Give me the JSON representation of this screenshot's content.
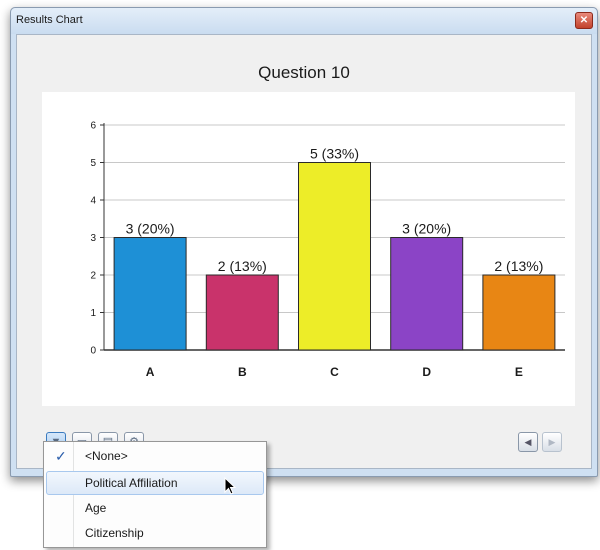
{
  "window": {
    "title": "Results Chart",
    "close_icon": "close-icon",
    "close_glyph": "✕"
  },
  "chart_data": {
    "type": "bar",
    "title": "Question 10",
    "categories": [
      "A",
      "B",
      "C",
      "D",
      "E"
    ],
    "values": [
      3,
      2,
      5,
      3,
      2
    ],
    "data_labels": [
      "3 (20%)",
      "2 (13%)",
      "5 (33%)",
      "3 (20%)",
      "2 (13%)"
    ],
    "colors": [
      "#1e90d6",
      "#c9336b",
      "#eded28",
      "#8b44c6",
      "#e88614"
    ],
    "ylim": [
      0,
      6
    ],
    "yticks": [
      "0",
      "1",
      "2",
      "3",
      "4",
      "5",
      "6"
    ],
    "xlabel": "",
    "ylabel": "",
    "grid": true
  },
  "toolbar": {
    "buttons": [
      {
        "name": "filter-button",
        "icon": "filter-icon",
        "glyph": "▼"
      },
      {
        "name": "window-button",
        "icon": "window-icon",
        "glyph": "▭"
      },
      {
        "name": "chart-options-button",
        "icon": "chart-options-icon",
        "glyph": "▤"
      },
      {
        "name": "settings-button",
        "icon": "settings-icon",
        "glyph": "⚙"
      }
    ],
    "nav": {
      "prev_glyph": "◀",
      "next_glyph": "▶"
    }
  },
  "dropdown": {
    "items": [
      {
        "label": "<None>",
        "checked": true
      },
      {
        "label": "Political Affiliation",
        "checked": false,
        "hover": true
      },
      {
        "label": "Age",
        "checked": false
      },
      {
        "label": "Citizenship",
        "checked": false
      }
    ],
    "check_glyph": "✓"
  }
}
